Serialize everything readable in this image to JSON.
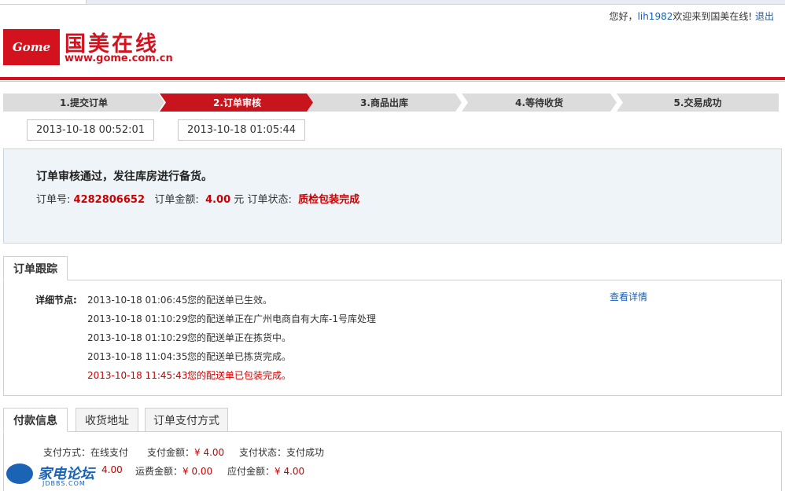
{
  "header": {
    "greeting": "您好，",
    "username": "lih1982",
    "welcome": "欢迎来到国美在线!",
    "logout": "退出",
    "logo_text": "Gome",
    "brand_cn": "国美在线",
    "brand_url": "www.gome.com.cn",
    "brand_color": "#d4121d"
  },
  "steps": [
    {
      "label": "1.提交订单",
      "state": "done"
    },
    {
      "label": "2.订单审核",
      "state": "current"
    },
    {
      "label": "3.商品出库",
      "state": "todo"
    },
    {
      "label": "4.等待收货",
      "state": "todo"
    },
    {
      "label": "5.交易成功",
      "state": "todo"
    }
  ],
  "step_times": [
    "2013-10-18 00:52:01",
    "2013-10-18 01:05:44"
  ],
  "order": {
    "message": "订单审核通过，发往库房进行备货。",
    "number_label": "订单号:",
    "number": "4282806652",
    "amount_label": "订单金额:",
    "amount": "4.00",
    "amount_unit": "元",
    "status_label": "订单状态:",
    "status": "质检包装完成"
  },
  "tracking": {
    "tab": "订单跟踪",
    "label": "详细节点:",
    "detail_link": "查看详情",
    "rows": [
      {
        "time": "2013-10-18 01:06:45",
        "text": "您的配送单已生效。"
      },
      {
        "time": "2013-10-18 01:10:29",
        "text": "您的配送单正在广州电商自有大库-1号库处理"
      },
      {
        "time": "2013-10-18 01:10:29",
        "text": "您的配送单正在拣货中。"
      },
      {
        "time": "2013-10-18 11:04:35",
        "text": "您的配送单已拣货完成。"
      },
      {
        "time": "2013-10-18 11:45:43",
        "text": "您的配送单已包装完成。"
      }
    ]
  },
  "payment": {
    "tabs": [
      "付款信息",
      "收货地址",
      "订单支付方式"
    ],
    "method_label": "支付方式：",
    "method": "在线支付",
    "paid_label": "支付金额：",
    "paid": "¥ 4.00",
    "state_label": "支付状态：",
    "state": "支付成功",
    "goods_amount": "4.00",
    "shipping_label": "运费金额：",
    "shipping": "¥ 0.00",
    "due_label": "应付金额：",
    "due": "¥ 4.00"
  },
  "watermark": {
    "title": "家电论坛",
    "sub": "JDBBS.COM"
  }
}
